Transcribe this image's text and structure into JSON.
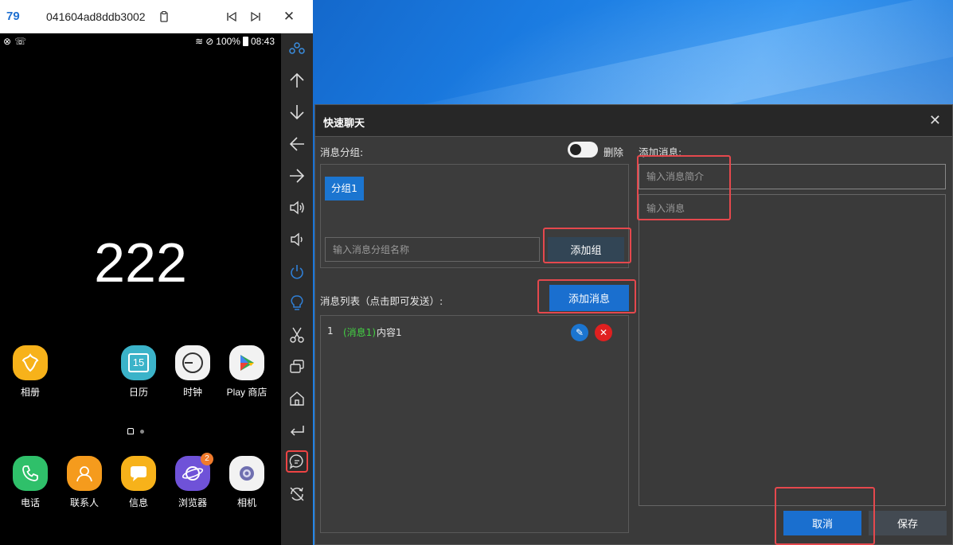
{
  "phone": {
    "title_id": "79",
    "serial": "041604ad8ddb3002",
    "status": {
      "battery": "100%",
      "time": "08:43"
    },
    "clock": "222",
    "apps_row1": [
      {
        "label": "相册",
        "color": "#f7b21a",
        "icon": "flower-icon"
      },
      {
        "label": "日历",
        "color": "#3bb3c9",
        "icon": "calendar-icon",
        "glyph": "15"
      },
      {
        "label": "时钟",
        "color": "#f2f2f2",
        "icon": "clock-icon"
      },
      {
        "label": "Play 商店",
        "color": "#f2f2f2",
        "icon": "play-store-icon"
      }
    ],
    "apps_row2": [
      {
        "label": "电话",
        "color": "#2fc06a",
        "icon": "phone-icon"
      },
      {
        "label": "联系人",
        "color": "#f59b1d",
        "icon": "contact-icon"
      },
      {
        "label": "信息",
        "color": "#f7b21a",
        "icon": "message-icon"
      },
      {
        "label": "浏览器",
        "color": "#6f52d8",
        "icon": "browser-icon",
        "badge": "2"
      },
      {
        "label": "相机",
        "color": "#f2f2f2",
        "icon": "camera-icon"
      }
    ]
  },
  "dialog": {
    "title": "快速聊天",
    "group_section_label": "消息分组:",
    "delete_toggle_label": "删除",
    "groups": [
      "分组1"
    ],
    "group_name_placeholder": "输入消息分组名称",
    "add_group_button": "添加组",
    "message_list_label": "消息列表（点击即可发送）:",
    "add_message_button": "添加消息",
    "messages": [
      {
        "index": "1",
        "tag": "(消息1)",
        "content": "内容1"
      }
    ],
    "add_message_section_label": "添加消息:",
    "summary_placeholder": "输入消息简介",
    "message_placeholder": "输入消息",
    "cancel_button": "取消",
    "save_button": "保存"
  },
  "colors": {
    "accent_blue": "#1a6fcf",
    "highlight_red": "#e5484d",
    "message_tag_green": "#43d143"
  }
}
